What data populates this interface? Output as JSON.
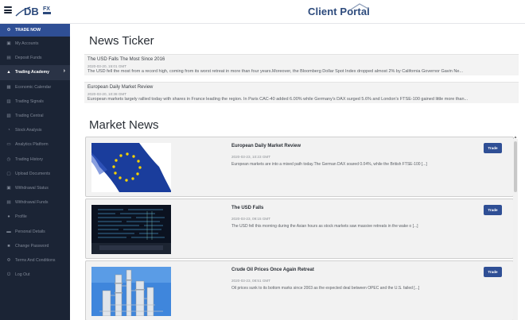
{
  "header": {
    "logo_text": "DB",
    "logo_suffix": "FX",
    "portal_title": "Client Portal"
  },
  "sidebar": {
    "items": [
      {
        "label": "TRADE NOW",
        "icon": "gear-icon"
      },
      {
        "label": "My Accounts",
        "icon": "wallet-icon"
      },
      {
        "label": "Deposit Funds",
        "icon": "deposit-icon"
      },
      {
        "label": "Trading Academy",
        "icon": "graduation-cap-icon"
      },
      {
        "label": "Economic Calendar",
        "icon": "calendar-icon"
      },
      {
        "label": "Trading Signals",
        "icon": "signal-icon"
      },
      {
        "label": "Trading Central",
        "icon": "chart-icon"
      },
      {
        "label": "Stock Analysis",
        "icon": "analysis-icon"
      },
      {
        "label": "Analytics Platform",
        "icon": "monitor-icon"
      },
      {
        "label": "Trading History",
        "icon": "history-icon"
      },
      {
        "label": "Upload Documents",
        "icon": "upload-icon"
      },
      {
        "label": "Withdrawal Status",
        "icon": "status-icon"
      },
      {
        "label": "Withdrawal Funds",
        "icon": "withdraw-icon"
      },
      {
        "label": "Profile",
        "icon": "user-icon"
      },
      {
        "label": "Personal Details",
        "icon": "id-card-icon"
      },
      {
        "label": "Change Password",
        "icon": "lock-icon"
      },
      {
        "label": "Terms And Conditions",
        "icon": "gear-icon"
      },
      {
        "label": "Log Out",
        "icon": "power-icon"
      }
    ]
  },
  "news_ticker": {
    "heading": "News Ticker",
    "items": [
      {
        "title": "The USD Falls The Most Since 2016",
        "date": "2020-03-20, 15:01 GMT",
        "text": "The USD fell the most from a record high, coming from its worst retreat in more than four years.Moreover, the Bloomberg Dollar Spot Index dropped almost 2% by California Governor Gavin Ne..."
      },
      {
        "title": "European Daily Market Review",
        "date": "2020-03-20, 10:38 GMT",
        "text": "European markets largely rallied today with shares in France leading the region. In Paris CAC-40 added 6.00% while Germany's DAX surged 5.6% and London's FTSE-100 gained little more than..."
      }
    ]
  },
  "market_news": {
    "heading": "Market News",
    "trade_label": "Trade",
    "items": [
      {
        "title": "European Daily Market Review",
        "date": "2020-03-23, 10:23 GMT",
        "text": "European markets are into a mixed path today.The German DAX soared 0.04%, while the British FTSE-100 [...]"
      },
      {
        "title": "The USD Falls",
        "date": "2020-03-23, 09:15 GMT",
        "text": "The USD fell this morning during the Asian hours as stock markets saw massive retreats in the wake o [...]"
      },
      {
        "title": "Crude Oil Prices Once Again Retreat",
        "date": "2020-03-23, 08:51 GMT",
        "text": "Oil prices sunk to its bottom marks since 2003 as the expected deal between OPEC and the U.S. failed [...]"
      }
    ]
  },
  "colors": {
    "sidebar_bg": "#1b2435",
    "accent": "#2f4f95",
    "portal_title": "#2c4a7c"
  }
}
